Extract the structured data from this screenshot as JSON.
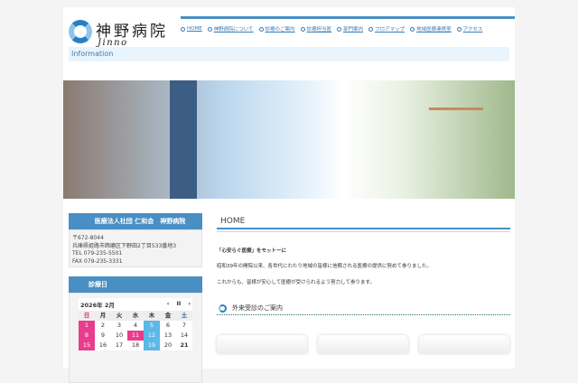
{
  "logo": {
    "jp": "神野病院",
    "en": "Jinno hospital"
  },
  "nav": [
    "HOME",
    "神野病院について",
    "診療のご案内",
    "診療担当医",
    "部門案内",
    "フロアマップ",
    "地域医療連携室",
    "アクセス"
  ],
  "info_label": "Information",
  "sidebar": {
    "org": "医療法人社団 仁和会　神野病院",
    "address": [
      "〒672-8044",
      "兵庫県姫路市飾磨区下野田2丁目533番地3",
      "TEL 079-235-5501",
      "FAX 079-235-3331"
    ],
    "calendar_title": "診療日",
    "calendar": {
      "month": "2026年 2月",
      "prev": "‹",
      "pause": "II",
      "next": "›",
      "weekdays": [
        "日",
        "月",
        "火",
        "水",
        "木",
        "金",
        "土"
      ],
      "days": [
        "1",
        "2",
        "3",
        "4",
        "5",
        "6",
        "7",
        "8",
        "9",
        "10",
        "11",
        "12",
        "13",
        "14",
        "15",
        "16",
        "17",
        "18",
        "19",
        "20",
        "21"
      ]
    }
  },
  "main": {
    "heading": "HOME",
    "motto": "「心安らぐ医療」をモットーに",
    "p1": "昭和39年の開院以来、各世代にわたり地域の皆様に信頼される医療の提供に努めて参りました。",
    "p2": "これからも、皆様が安心して医療が受けられるよう努力して参ります。",
    "section": "外来受診のご案内"
  }
}
